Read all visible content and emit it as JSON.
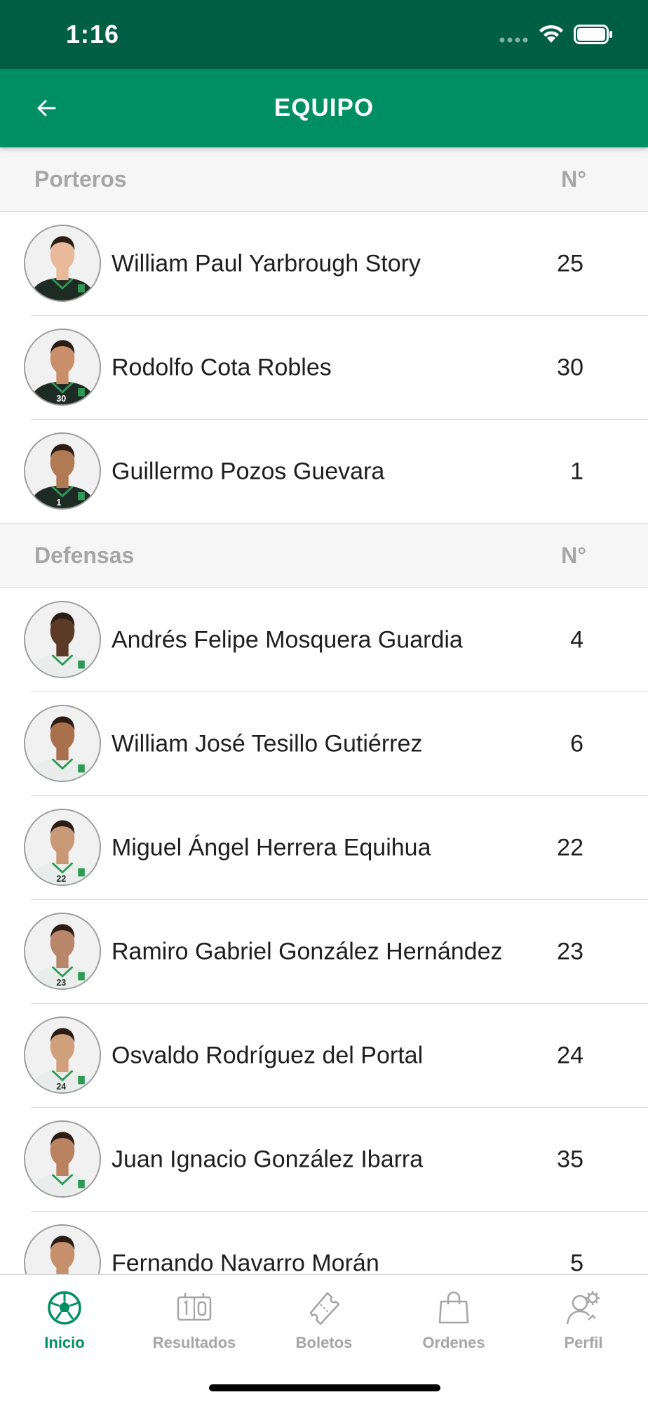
{
  "status_bar": {
    "time": "1:16"
  },
  "nav": {
    "title": "EQUIPO",
    "back_icon": "back-arrow-icon"
  },
  "sections": [
    {
      "title": "Porteros",
      "number_header": "N°",
      "players": [
        {
          "name": "William Paul Yarbrough Story",
          "number": "25",
          "kit": "dark",
          "shirt_no": ""
        },
        {
          "name": "Rodolfo Cota Robles",
          "number": "30",
          "kit": "dark",
          "shirt_no": "30"
        },
        {
          "name": "Guillermo Pozos Guevara",
          "number": "1",
          "kit": "dark",
          "shirt_no": "1"
        }
      ]
    },
    {
      "title": "Defensas",
      "number_header": "N°",
      "players": [
        {
          "name": "Andrés Felipe Mosquera Guardia",
          "number": "4",
          "kit": "light",
          "shirt_no": ""
        },
        {
          "name": "William José Tesillo Gutiérrez",
          "number": "6",
          "kit": "light",
          "shirt_no": ""
        },
        {
          "name": "Miguel Ángel Herrera Equihua",
          "number": "22",
          "kit": "light",
          "shirt_no": "22"
        },
        {
          "name": "Ramiro Gabriel González Hernández",
          "number": "23",
          "kit": "light",
          "shirt_no": "23"
        },
        {
          "name": "Osvaldo Rodríguez del Portal",
          "number": "24",
          "kit": "light",
          "shirt_no": "24"
        },
        {
          "name": "Juan Ignacio González Ibarra",
          "number": "35",
          "kit": "light",
          "shirt_no": ""
        },
        {
          "name": "Fernando Navarro Morán",
          "number": "5",
          "kit": "light",
          "shirt_no": ""
        }
      ]
    }
  ],
  "tabs": [
    {
      "label": "Inicio",
      "icon": "soccer-ball-icon",
      "active": true
    },
    {
      "label": "Resultados",
      "icon": "scoreboard-icon",
      "active": false
    },
    {
      "label": "Boletos",
      "icon": "ticket-icon",
      "active": false
    },
    {
      "label": "Ordenes",
      "icon": "shopping-bag-icon",
      "active": false
    },
    {
      "label": "Perfil",
      "icon": "user-gear-icon",
      "active": false
    }
  ],
  "colors": {
    "status_bar": "#005f43",
    "nav_bar": "#008f63",
    "accent": "#008f63",
    "inactive_tab": "#a5a5a5"
  }
}
